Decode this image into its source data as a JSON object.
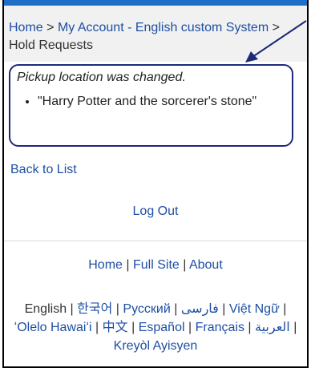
{
  "breadcrumb": {
    "home": "Home",
    "sep1": ">",
    "my_account": "My Account - English custom System",
    "sep2": ">",
    "current": "Hold Requests"
  },
  "notice": {
    "message": "Pickup location was changed.",
    "items": [
      "\"Harry Potter and the sorcerer's stone\""
    ]
  },
  "actions": {
    "back_label": "Back to List",
    "logout_label": "Log Out"
  },
  "footer": {
    "home": "Home",
    "full_site": "Full Site",
    "about": "About",
    "sep": "|",
    "languages": [
      "English",
      "한국어",
      "Русский",
      "فارسی",
      "Việt Ngữ",
      "ʻOlelo Hawaiʻi",
      "中文",
      "Español",
      "Français",
      "العربية",
      "Kreyòl Ayisyen"
    ]
  },
  "colors": {
    "accent": "#1f6fc6",
    "link": "#1e4fa3",
    "annotation": "#1d2a7a"
  },
  "icons": {
    "annotation_arrow": "arrow-icon"
  }
}
